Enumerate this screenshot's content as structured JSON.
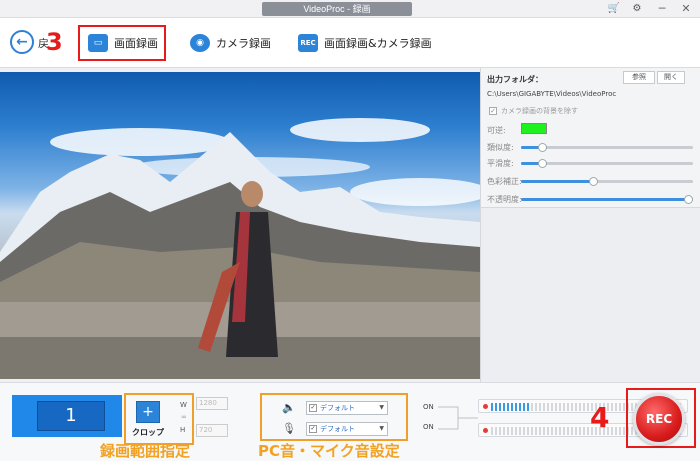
{
  "window": {
    "title": "VideoProc - 録画",
    "cart_icon": "cart-icon",
    "settings_icon": "gear-icon",
    "minimize": "─",
    "close": "✕"
  },
  "toolbar": {
    "back_label": "戻",
    "tabs": [
      {
        "label": "画面録画",
        "icon": "monitor-icon",
        "icon_text": ""
      },
      {
        "label": "カメラ録画",
        "icon": "camera-icon",
        "icon_text": ""
      },
      {
        "label": "画面録画&カメラ録画",
        "icon": "rec-icon",
        "icon_text": "REC"
      }
    ]
  },
  "annotations": {
    "step3": "3",
    "step4": "4",
    "crop_caption": "録画範囲指定",
    "audio_caption": "PC音・マイク音設定"
  },
  "panel": {
    "output_folder_label": "出力フォルダ：",
    "browse_button": "参照",
    "open_button": "開く",
    "output_path": "C:\\Users\\GIGABYTE\\Videos\\VideoProc",
    "remove_bg_label": "カメラ録画の背景を除す",
    "remove_bg_checked": true,
    "color_label": "可逆:",
    "key_color": "#1ef21e",
    "sliders": [
      {
        "label": "類似度:",
        "value": 0.12
      },
      {
        "label": "平滑度:",
        "value": 0.12
      },
      {
        "label": "色彩補正:",
        "value": 0.42
      },
      {
        "label": "不透明度:",
        "value": 1.0
      }
    ]
  },
  "bottom": {
    "recording_count": "1",
    "crop_label": "クロップ",
    "w_label": "W",
    "h_label": "H",
    "w_value": "1280",
    "h_value": "720",
    "audio": [
      {
        "icon": "speaker-icon",
        "value": "デフォルト",
        "checked": true,
        "status": "ON",
        "level": 0.2
      },
      {
        "icon": "microphone-icon",
        "value": "デフォルト",
        "checked": true,
        "status": "ON",
        "level": 0.0
      }
    ],
    "rec_label": "REC"
  }
}
